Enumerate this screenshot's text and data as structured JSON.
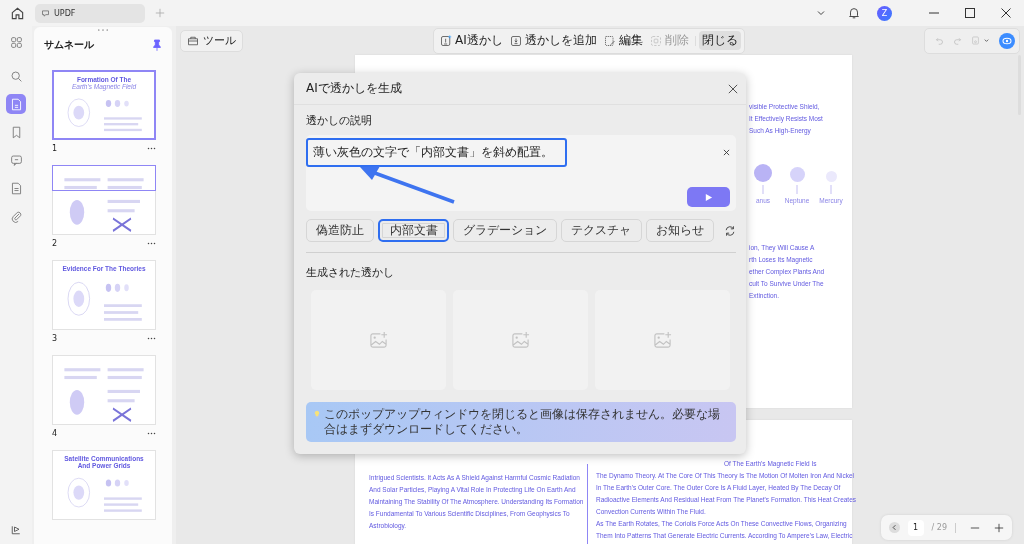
{
  "app_tabs": [
    {
      "label": "UPDF",
      "selected": true
    }
  ],
  "account": {
    "avatar": "Z"
  },
  "rail": [
    {
      "kind": "grid",
      "selected": false
    },
    {
      "kind": "search",
      "selected": false
    },
    {
      "kind": "pages",
      "selected": true
    },
    {
      "kind": "bookmark",
      "selected": false
    },
    {
      "kind": "comment",
      "selected": false
    },
    {
      "kind": "form",
      "selected": false
    },
    {
      "kind": "attachment",
      "selected": false
    }
  ],
  "thumbnail_panel": {
    "title": "サムネール",
    "pinned": true,
    "thumbnails": [
      {
        "page": "1",
        "title": "Formation Of The",
        "subtitle": "Earth's Magnetic Field",
        "selected": true,
        "in_view": false
      },
      {
        "page": "2",
        "selected": false,
        "in_view": true
      },
      {
        "page": "3",
        "title": "Evidence For The Theories",
        "selected": false,
        "in_view": false
      },
      {
        "page": "4",
        "selected": false,
        "in_view": false
      },
      {
        "title": "Satellite Communications And Power Grids",
        "selected": false,
        "in_view": false
      }
    ]
  },
  "toolbar": {
    "tools_label": "ツール",
    "watermark_tools": [
      {
        "kind": "ai",
        "label": "AI透かし",
        "selected": false,
        "disabled": false
      },
      {
        "kind": "add",
        "label": "透かしを追加",
        "selected": false,
        "disabled": false
      },
      {
        "kind": "edit",
        "label": "編集",
        "selected": false,
        "disabled": false
      },
      {
        "kind": "delete",
        "label": "削除",
        "selected": false,
        "disabled": true
      },
      {
        "kind": "close",
        "label": "閉じる",
        "selected": true,
        "disabled": false
      }
    ]
  },
  "document": {
    "page1_lines_top": [
      "visible Protective Shield,",
      "It Effectively Resists Most",
      "Such As High-Energy"
    ],
    "planets": [
      {
        "label": "anus",
        "color": "#b9b3f5"
      },
      {
        "label": "Neptune",
        "color": "#d6d3fa"
      },
      {
        "label": "Mercury",
        "color": "#ebe9fc"
      }
    ],
    "page1_lines_bottom": [
      "ion, They Will Cause A",
      "rth Loses Its Magnetic",
      "ether Complex Plants And",
      "cult To Survive Under The",
      "Extinction."
    ],
    "page2_left": [
      "Intrigued Scientists. It Acts As A Shield Against Harmful Cosmic Radiation",
      "And Solar Particles, Playing A Vital Role In Protecting Life On Earth And",
      "Maintaining The Stability Of The Atmosphere. Understanding Its Formation",
      "Is Fundamental To Various Scientific Disciplines, From Geophysics To",
      "Astrobiology."
    ],
    "page2_right_head": "Of The Earth's Magnetic Field Is",
    "page2_right": [
      "The Dynamo Theory. At The Core Of This Theory Is The Motion Of Molten Iron And Nickel",
      "In The Earth's Outer Core. The Outer Core Is A Fluid Layer, Heated By The Decay Of",
      "Radioactive Elements And Residual Heat From The Planet's Formation. This Heat Creates",
      "Convection Currents Within The Fluid.",
      "As The Earth Rotates, The Coriolis Force Acts On These Convective Flows, Organizing",
      "Them Into Patterns That Generate Electric Currents. According To Ampere's Law, Electric"
    ]
  },
  "pager": {
    "page": "1",
    "total": "/ 29"
  },
  "dialog": {
    "title": "AIで透かしを生成",
    "description_label": "透かしの説明",
    "prompt": {
      "value": "薄い灰色の文字で「内部文書」を斜め配置。",
      "highlighted": true
    },
    "presets": [
      {
        "label": "偽造防止",
        "highlighted": false
      },
      {
        "label": "内部文書",
        "highlighted": true
      },
      {
        "label": "グラデーション",
        "highlighted": false
      },
      {
        "label": "テクスチャ",
        "highlighted": false
      },
      {
        "label": "お知らせ",
        "highlighted": false
      }
    ],
    "results_label": "生成された透かし",
    "results": [
      {
        "kind": "empty"
      },
      {
        "kind": "empty"
      },
      {
        "kind": "empty"
      }
    ],
    "notice": "このポップアップウィンドウを閉じると画像は保存されません。必要な場合はまずダウンロードしてください。"
  }
}
